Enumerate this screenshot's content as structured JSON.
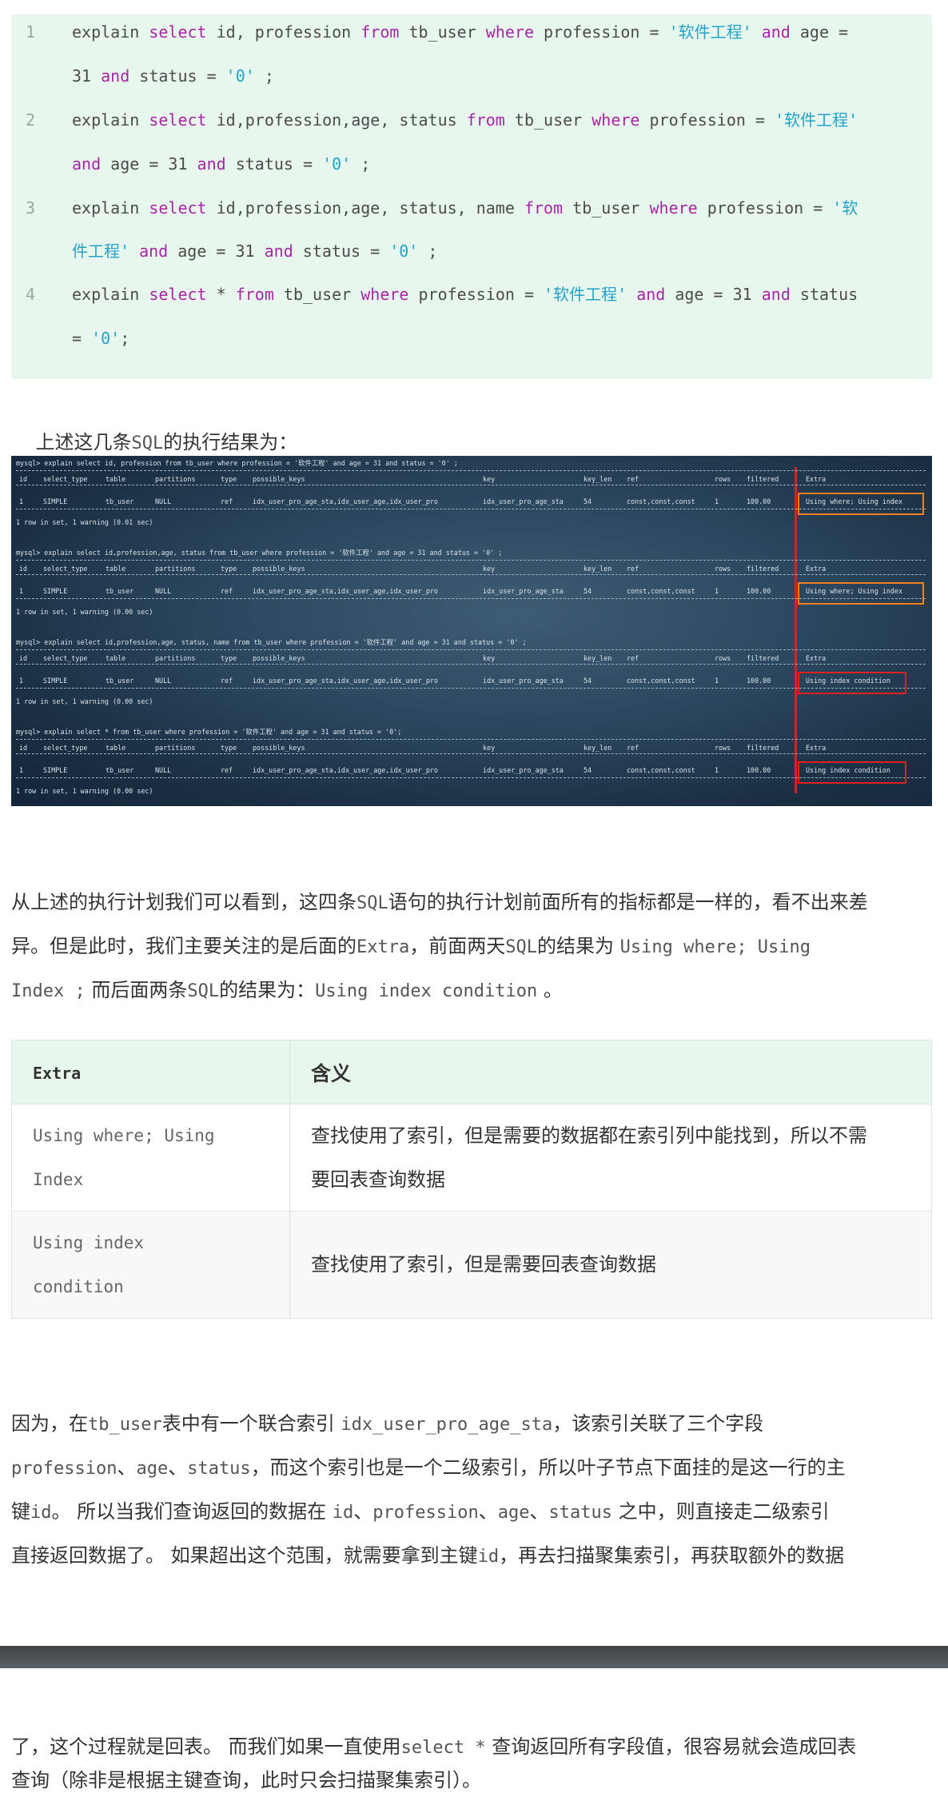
{
  "code_block": {
    "lines": [
      {
        "number": "1",
        "rows": [
          [
            [
              "t",
              "explain "
            ],
            [
              "k",
              "select"
            ],
            [
              "t",
              " id, profession "
            ],
            [
              "k",
              "from"
            ],
            [
              "t",
              " tb_user "
            ],
            [
              "k",
              "where"
            ],
            [
              "t",
              " profession = "
            ],
            [
              "s",
              "'软件工程'"
            ],
            [
              "t",
              " "
            ],
            [
              "k",
              "and"
            ],
            [
              "t",
              " age ="
            ]
          ],
          [
            [
              "t",
              "31 "
            ],
            [
              "k",
              "and"
            ],
            [
              "t",
              " status = "
            ],
            [
              "s",
              "'0'"
            ],
            [
              "t",
              " ;"
            ]
          ]
        ]
      },
      {
        "number": "2",
        "rows": [
          [
            [
              "t",
              "explain "
            ],
            [
              "k",
              "select"
            ],
            [
              "t",
              " id,profession,age, status "
            ],
            [
              "k",
              "from"
            ],
            [
              "t",
              " tb_user "
            ],
            [
              "k",
              "where"
            ],
            [
              "t",
              " profession = "
            ],
            [
              "s",
              "'软件工程'"
            ]
          ],
          [
            [
              "k",
              "and"
            ],
            [
              "t",
              " age = 31 "
            ],
            [
              "k",
              "and"
            ],
            [
              "t",
              " status = "
            ],
            [
              "s",
              "'0'"
            ],
            [
              "t",
              " ;"
            ]
          ]
        ]
      },
      {
        "number": "3",
        "rows": [
          [
            [
              "t",
              "explain "
            ],
            [
              "k",
              "select"
            ],
            [
              "t",
              " id,profession,age, status, name "
            ],
            [
              "k",
              "from"
            ],
            [
              "t",
              " tb_user "
            ],
            [
              "k",
              "where"
            ],
            [
              "t",
              " profession = "
            ],
            [
              "s",
              "'软"
            ]
          ],
          [
            [
              "s",
              "件工程'"
            ],
            [
              "t",
              " "
            ],
            [
              "k",
              "and"
            ],
            [
              "t",
              " age = 31 "
            ],
            [
              "k",
              "and"
            ],
            [
              "t",
              " status = "
            ],
            [
              "s",
              "'0'"
            ],
            [
              "t",
              " ;"
            ]
          ]
        ]
      },
      {
        "number": "4",
        "rows": [
          [
            [
              "t",
              "explain "
            ],
            [
              "k",
              "select"
            ],
            [
              "t",
              " * "
            ],
            [
              "k",
              "from"
            ],
            [
              "t",
              " tb_user "
            ],
            [
              "k",
              "where"
            ],
            [
              "t",
              " profession = "
            ],
            [
              "s",
              "'软件工程'"
            ],
            [
              "t",
              " "
            ],
            [
              "k",
              "and"
            ],
            [
              "t",
              " age = 31 "
            ],
            [
              "k",
              "and"
            ],
            [
              "t",
              " status"
            ]
          ],
          [
            [
              "t",
              "= "
            ],
            [
              "s",
              "'0'"
            ],
            [
              "t",
              ";"
            ]
          ]
        ]
      }
    ]
  },
  "intro_text": {
    "before": "上述这几条",
    "code": "SQL",
    "after": "的执行结果为："
  },
  "terminal": {
    "blocks": [
      {
        "prompt": "mysql> explain select id, profession from tb_user where profession = '软件工程' and age = 31 and status = '0' ;",
        "row": {
          "id": "1",
          "select_type": "SIMPLE",
          "table": "tb_user",
          "partitions": "NULL",
          "type": "ref",
          "possible_keys": "idx_user_pro_age_sta,idx_user_age,idx_user_pro",
          "key": "idx_user_pro_age_sta",
          "key_len": "54",
          "ref": "const,const,const",
          "rows": "1",
          "filtered": "100.00",
          "extra": "Using where; Using index"
        },
        "footer": "1 row in set, 1 warning (0.01 sec)"
      },
      {
        "prompt": "mysql> explain select id,profession,age, status from tb_user where profession = '软件工程' and age = 31 and status = '0' ;",
        "row": {
          "id": "1",
          "select_type": "SIMPLE",
          "table": "tb_user",
          "partitions": "NULL",
          "type": "ref",
          "possible_keys": "idx_user_pro_age_sta,idx_user_age,idx_user_pro",
          "key": "idx_user_pro_age_sta",
          "key_len": "54",
          "ref": "const,const,const",
          "rows": "1",
          "filtered": "100.00",
          "extra": "Using where; Using index"
        },
        "footer": "1 row in set, 1 warning (0.00 sec)"
      },
      {
        "prompt": "mysql> explain select id,profession,age, status, name from tb_user where profession = '软件工程' and age = 31 and status = '0' ;",
        "row": {
          "id": "1",
          "select_type": "SIMPLE",
          "table": "tb_user",
          "partitions": "NULL",
          "type": "ref",
          "possible_keys": "idx_user_pro_age_sta,idx_user_age,idx_user_pro",
          "key": "idx_user_pro_age_sta",
          "key_len": "54",
          "ref": "const,const,const",
          "rows": "1",
          "filtered": "100.00",
          "extra": "Using index condition"
        },
        "footer": "1 row in set, 1 warning (0.00 sec)"
      },
      {
        "prompt": "mysql> explain select * from tb_user where profession = '软件工程' and age = 31 and status = '0';",
        "row": {
          "id": "1",
          "select_type": "SIMPLE",
          "table": "tb_user",
          "partitions": "NULL",
          "type": "ref",
          "possible_keys": "idx_user_pro_age_sta,idx_user_age,idx_user_pro",
          "key": "idx_user_pro_age_sta",
          "key_len": "54",
          "ref": "const,const,const",
          "rows": "1",
          "filtered": "100.00",
          "extra": "Using index condition"
        },
        "footer": "1 row in set, 1 warning (0.00 sec)"
      }
    ],
    "headers": {
      "id": "id",
      "select_type": "select_type",
      "table": "table",
      "partitions": "partitions",
      "type": "type",
      "possible_keys": "possible_keys",
      "key": "key",
      "key_len": "key_len",
      "ref": "ref",
      "rows": "rows",
      "filtered": "filtered",
      "extra": "Extra"
    },
    "colors": {
      "orange_box": "#f0801e",
      "red_box": "#e02020",
      "red_line": "#e02020"
    }
  },
  "analysis_paragraph": {
    "lines": [
      [
        [
          "t",
          "从上述的执行计划我们可以看到，这四条"
        ],
        [
          "c",
          "SQL"
        ],
        [
          "t",
          "语句的执行计划前面所有的指标都是一样的，看不出来差"
        ]
      ],
      [
        [
          "t",
          "异。但是此时，我们主要关注的是后面的"
        ],
        [
          "c",
          "Extra"
        ],
        [
          "t",
          "，前面两天"
        ],
        [
          "c",
          "SQL"
        ],
        [
          "t",
          "的结果为 "
        ],
        [
          "c",
          "Using where; Using"
        ]
      ],
      [
        [
          "c",
          "Index ;"
        ],
        [
          "t",
          " 而后面两条"
        ],
        [
          "c",
          "SQL"
        ],
        [
          "t",
          "的结果为："
        ],
        [
          "c",
          "Using index condition"
        ],
        [
          "t",
          " 。"
        ]
      ]
    ]
  },
  "extra_table": {
    "headers": [
      "Extra",
      "含义"
    ],
    "rows": [
      {
        "extra_lines": [
          "Using where; Using",
          "Index"
        ],
        "meaning_lines": [
          "查找使用了索引，但是需要的数据都在索引列中能找到，所以不需",
          "要回表查询数据"
        ]
      },
      {
        "extra_lines": [
          "Using index",
          "condition"
        ],
        "meaning_lines": [
          "查找使用了索引，但是需要回表查询数据"
        ]
      }
    ]
  },
  "reason_paragraph": {
    "lines": [
      [
        [
          "t",
          "因为，在"
        ],
        [
          "c",
          "tb_user"
        ],
        [
          "t",
          "表中有一个联合索引 "
        ],
        [
          "c",
          "idx_user_pro_age_sta"
        ],
        [
          "t",
          "，该索引关联了三个字段"
        ]
      ],
      [
        [
          "c",
          "profession"
        ],
        [
          "t",
          "、"
        ],
        [
          "c",
          "age"
        ],
        [
          "t",
          "、"
        ],
        [
          "c",
          "status"
        ],
        [
          "t",
          "，而这个索引也是一个二级索引，所以叶子节点下面挂的是这一行的主"
        ]
      ],
      [
        [
          "t",
          "键"
        ],
        [
          "c",
          "id"
        ],
        [
          "t",
          "。 所以当我们查询返回的数据在 "
        ],
        [
          "c",
          "id"
        ],
        [
          "t",
          "、"
        ],
        [
          "c",
          "profession"
        ],
        [
          "t",
          "、"
        ],
        [
          "c",
          "age"
        ],
        [
          "t",
          "、"
        ],
        [
          "c",
          "status"
        ],
        [
          "t",
          " 之中，则直接走二级索引"
        ]
      ],
      [
        [
          "t",
          "直接返回数据了。 如果超出这个范围，就需要拿到主键"
        ],
        [
          "c",
          "id"
        ],
        [
          "t",
          "，再去扫描聚集索引，再获取额外的数据"
        ]
      ]
    ]
  },
  "closing_paragraph": {
    "lines": [
      [
        [
          "t",
          "了，这个过程就是回表。 而我们如果一直使用"
        ],
        [
          "c",
          "select *"
        ],
        [
          "t",
          " 查询返回所有字段值，很容易就会造成回表"
        ]
      ],
      [
        [
          "t",
          "查询（除非是根据主键查询，此时只会扫描聚集索引）。"
        ]
      ]
    ]
  }
}
